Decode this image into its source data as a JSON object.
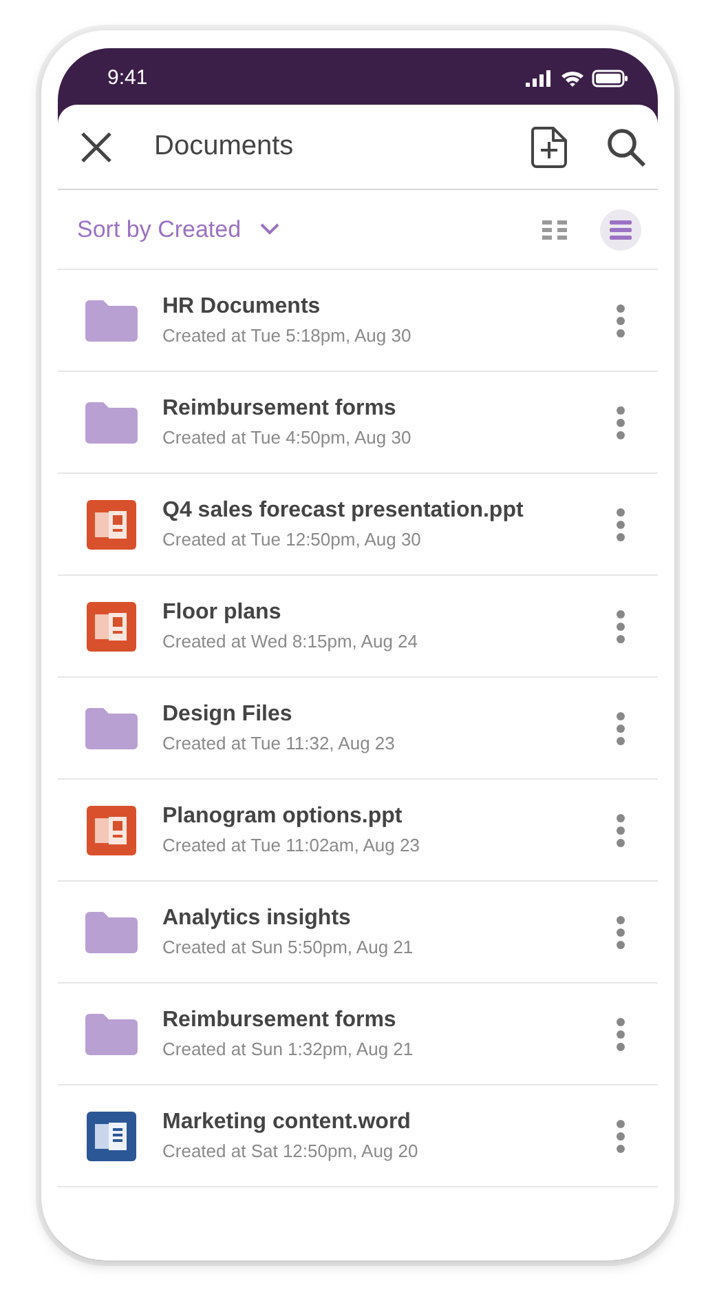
{
  "status_bar": {
    "time": "9:41"
  },
  "toolbar": {
    "title": "Documents"
  },
  "sort": {
    "label": "Sort by Created"
  },
  "view_options": [
    {
      "kind": "grid",
      "selected": false
    },
    {
      "kind": "list",
      "selected": true
    }
  ],
  "documents": [
    {
      "kind": "folder",
      "name": "HR Documents",
      "created": "Created at Tue 5:18pm, Aug 30"
    },
    {
      "kind": "folder",
      "name": "Reimbursement forms",
      "created": "Created at Tue 4:50pm, Aug 30"
    },
    {
      "kind": "ppt",
      "name": "Q4 sales forecast presentation.ppt",
      "created": "Created at Tue 12:50pm, Aug 30"
    },
    {
      "kind": "ppt",
      "name": "Floor plans",
      "created": "Created at Wed 8:15pm, Aug 24"
    },
    {
      "kind": "folder",
      "name": "Design Files",
      "created": "Created at Tue 11:32, Aug 23"
    },
    {
      "kind": "ppt",
      "name": "Planogram options.ppt",
      "created": "Created at Tue 11:02am, Aug 23"
    },
    {
      "kind": "folder",
      "name": "Analytics insights",
      "created": "Created at Sun 5:50pm, Aug 21"
    },
    {
      "kind": "folder",
      "name": "Reimbursement forms",
      "created": "Created at Sun 1:32pm, Aug 21"
    },
    {
      "kind": "word",
      "name": "Marketing content.word",
      "created": "Created at Sat 12:50pm, Aug 20"
    }
  ]
}
